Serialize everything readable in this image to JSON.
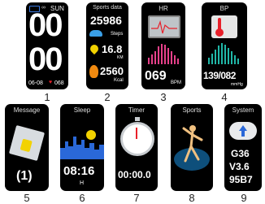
{
  "screens": [
    {
      "number": "1",
      "status_day": "SUN",
      "digits_top": "00",
      "digits_bottom": "00",
      "date": "06-08",
      "heart": "068"
    },
    {
      "number": "2",
      "title": "Sports data",
      "steps": "25986",
      "steps_unit": "Steps",
      "distance": "16.8",
      "distance_unit": "KM",
      "calories": "2560",
      "calories_unit": "Kcal"
    },
    {
      "number": "3",
      "title": "HR",
      "value": "069",
      "unit": "BPM"
    },
    {
      "number": "4",
      "title": "BP",
      "value": "139/082",
      "unit": "mmHg"
    },
    {
      "number": "5",
      "title": "Message",
      "count": "(1)"
    },
    {
      "number": "6",
      "title": "Sleep",
      "time": "08:16",
      "unit": "H"
    },
    {
      "number": "7",
      "title": "Timer",
      "time": "00:00.0"
    },
    {
      "number": "8",
      "title": "Sports"
    },
    {
      "number": "9",
      "title": "System",
      "line1": "G36",
      "line2": "V3.6",
      "line3": "95B7"
    }
  ],
  "colors": {
    "screen_bg": "#000000",
    "accent_red": "#e8202a",
    "steps_blue": "#3aa0e8",
    "distance_yellow": "#f2d200",
    "flame_orange": "#f08a10",
    "hr_pink": "#e8408a",
    "bp_teal": "#20b8a8",
    "sleep_blue": "#2a68d8",
    "sports_blue": "#1a90e0"
  },
  "icons": {
    "battery": "battery-icon",
    "link": "link-icon",
    "heart": "heart-icon",
    "shoe": "shoe-icon",
    "pin": "location-pin-icon",
    "flame": "flame-icon",
    "monitor": "ecg-monitor-icon",
    "thermometer": "thermometer-icon",
    "envelope": "envelope-icon",
    "city": "city-skyline-icon",
    "stopwatch": "stopwatch-icon",
    "runner": "runner-icon",
    "cloud": "cloud-upload-icon"
  }
}
